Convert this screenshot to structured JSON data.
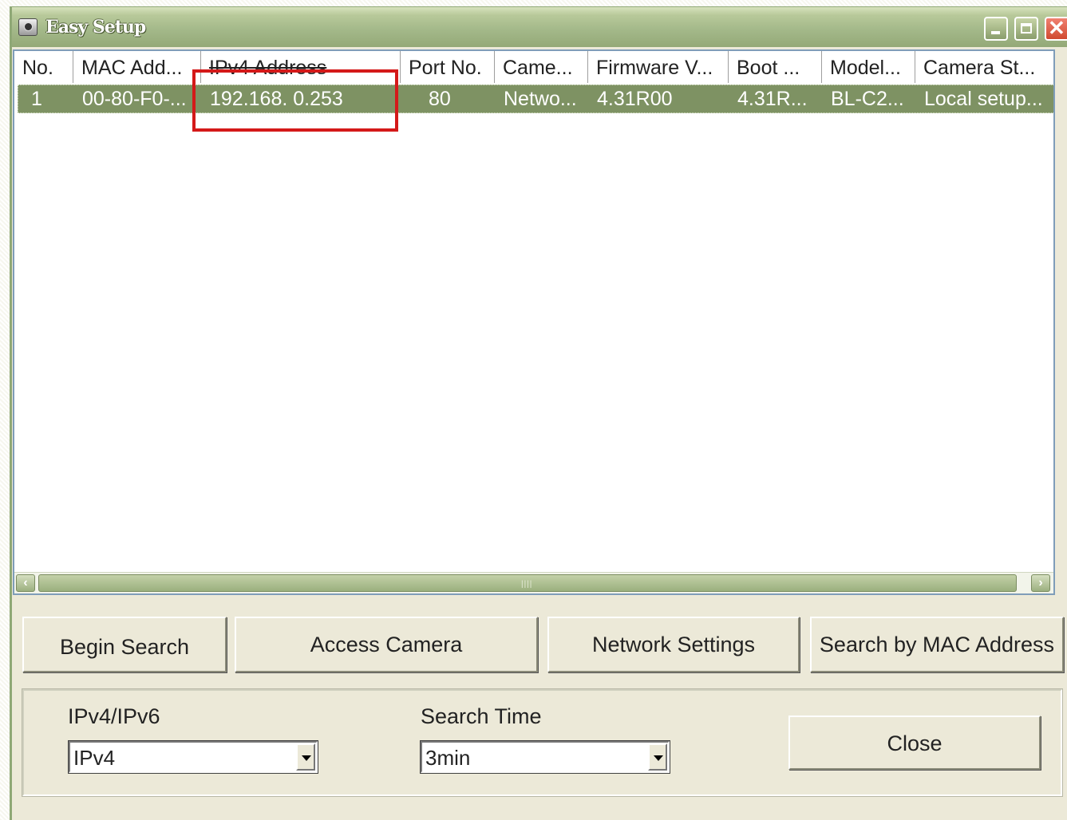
{
  "window": {
    "title": "Easy Setup"
  },
  "table": {
    "columns": [
      "No.",
      "MAC Add...",
      "IPv4 Address",
      "Port No.",
      "Came...",
      "Firmware V...",
      "Boot ...",
      "Model...",
      "Camera St..."
    ],
    "rows": [
      {
        "no": "1",
        "mac": "00-80-F0-...",
        "ipv4": "192.168.  0.253",
        "port": "80",
        "camera": "Netwo...",
        "firmware": "4.31R00",
        "boot": "4.31R...",
        "model": "BL-C2...",
        "status": "Local setup..."
      }
    ]
  },
  "buttons": {
    "begin_search": "Begin Search",
    "access_camera": "Access Camera",
    "network_settings": "Network Settings",
    "search_by_mac": "Search by MAC Address",
    "close": "Close"
  },
  "settings": {
    "ip_version_label": "IPv4/IPv6",
    "ip_version_value": "IPv4",
    "search_time_label": "Search Time",
    "search_time_value": "3min"
  },
  "colors": {
    "titlebar": "#a4b98a",
    "selected_row": "#7e9263",
    "highlight_box": "#d41919"
  }
}
